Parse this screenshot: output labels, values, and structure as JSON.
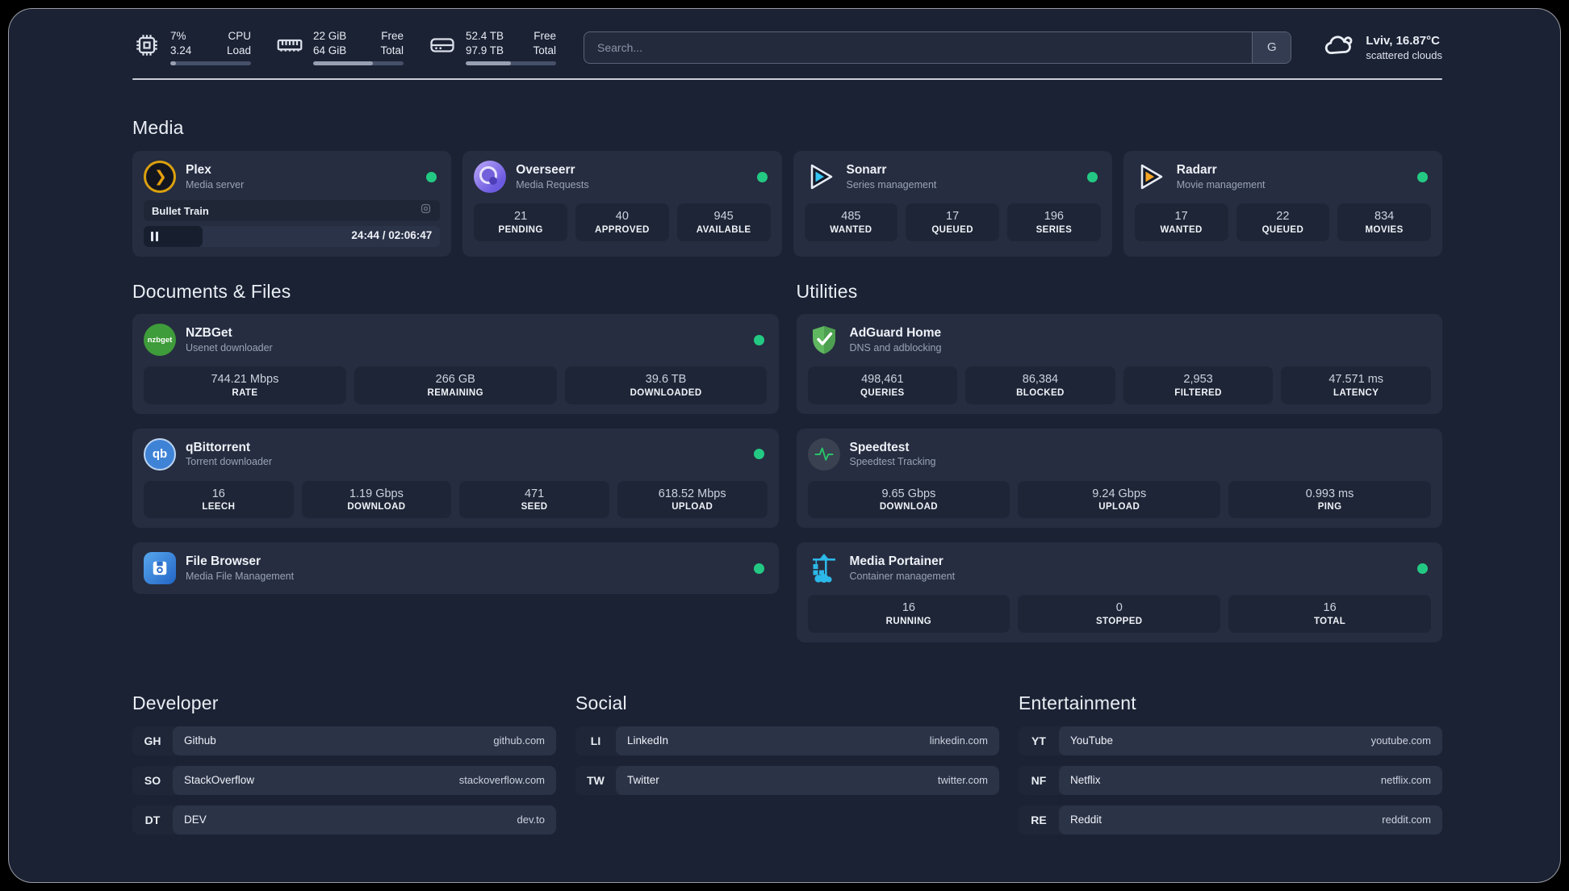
{
  "colors": {
    "page_bg": "#1b2234",
    "card_bg": "#262d40",
    "tile_bg": "#1e2536",
    "status_online": "#23c983",
    "plex_amber": "#e5a00d",
    "sonarr_blue": "#35c5f4",
    "radarr_amber": "#f5a623",
    "portainer_blue": "#2cb8e8"
  },
  "topbar": {
    "system": [
      {
        "icon": "cpu-icon",
        "value1": "7%",
        "value2": "3.24",
        "label1": "CPU",
        "label2": "Load",
        "progress_pct": 7
      },
      {
        "icon": "ram-icon",
        "value1": "22 GiB",
        "value2": "64 GiB",
        "label1": "Free",
        "label2": "Total",
        "progress_pct": 66
      },
      {
        "icon": "disk-icon",
        "value1": "52.4 TB",
        "value2": "97.9 TB",
        "label1": "Free",
        "label2": "Total",
        "progress_pct": 50
      }
    ],
    "search": {
      "placeholder": "Search...",
      "engine_button": "G"
    },
    "weather": {
      "icon": "scattered-clouds-icon",
      "location_temp": "Lviv, 16.87°C",
      "condition": "scattered clouds"
    }
  },
  "media": {
    "title": "Media",
    "plex": {
      "icon": "plex-icon",
      "name": "Plex",
      "desc": "Media server",
      "online": true,
      "now_playing": "Bullet Train",
      "time": "24:44 / 02:06:47",
      "progress_pct": 20
    },
    "cards": [
      {
        "icon": "overseerr-icon",
        "name": "Overseerr",
        "desc": "Media Requests",
        "online": true,
        "stats": [
          {
            "value": "21",
            "label": "PENDING"
          },
          {
            "value": "40",
            "label": "APPROVED"
          },
          {
            "value": "945",
            "label": "AVAILABLE"
          }
        ]
      },
      {
        "icon": "sonarr-icon",
        "name": "Sonarr",
        "desc": "Series management",
        "online": true,
        "stats": [
          {
            "value": "485",
            "label": "WANTED"
          },
          {
            "value": "17",
            "label": "QUEUED"
          },
          {
            "value": "196",
            "label": "SERIES"
          }
        ]
      },
      {
        "icon": "radarr-icon",
        "name": "Radarr",
        "desc": "Movie management",
        "online": true,
        "stats": [
          {
            "value": "17",
            "label": "WANTED"
          },
          {
            "value": "22",
            "label": "QUEUED"
          },
          {
            "value": "834",
            "label": "MOVIES"
          }
        ]
      }
    ]
  },
  "documents": {
    "title": "Documents & Files",
    "cards": [
      {
        "icon": "nzbget-icon",
        "name": "NZBGet",
        "desc": "Usenet downloader",
        "online": true,
        "stats": [
          {
            "value": "744.21 Mbps",
            "label": "RATE"
          },
          {
            "value": "266 GB",
            "label": "REMAINING"
          },
          {
            "value": "39.6 TB",
            "label": "DOWNLOADED"
          }
        ]
      },
      {
        "icon": "qbittorrent-icon",
        "name": "qBittorrent",
        "desc": "Torrent downloader",
        "online": true,
        "stats": [
          {
            "value": "16",
            "label": "LEECH"
          },
          {
            "value": "1.19 Gbps",
            "label": "DOWNLOAD"
          },
          {
            "value": "471",
            "label": "SEED"
          },
          {
            "value": "618.52 Mbps",
            "label": "UPLOAD"
          }
        ]
      },
      {
        "icon": "filebrowser-icon",
        "name": "File Browser",
        "desc": "Media File Management",
        "online": true,
        "stats": []
      }
    ]
  },
  "utilities": {
    "title": "Utilities",
    "cards": [
      {
        "icon": "adguard-icon",
        "name": "AdGuard Home",
        "desc": "DNS and adblocking",
        "online": false,
        "stats": [
          {
            "value": "498,461",
            "label": "QUERIES"
          },
          {
            "value": "86,384",
            "label": "BLOCKED"
          },
          {
            "value": "2,953",
            "label": "FILTERED"
          },
          {
            "value": "47.571 ms",
            "label": "LATENCY"
          }
        ]
      },
      {
        "icon": "speedtest-icon",
        "name": "Speedtest",
        "desc": "Speedtest Tracking",
        "online": false,
        "stats": [
          {
            "value": "9.65 Gbps",
            "label": "DOWNLOAD"
          },
          {
            "value": "9.24 Gbps",
            "label": "UPLOAD"
          },
          {
            "value": "0.993 ms",
            "label": "PING"
          }
        ]
      },
      {
        "icon": "portainer-icon",
        "name": "Media Portainer",
        "desc": "Container management",
        "online": true,
        "stats": [
          {
            "value": "16",
            "label": "RUNNING"
          },
          {
            "value": "0",
            "label": "STOPPED"
          },
          {
            "value": "16",
            "label": "TOTAL"
          }
        ]
      }
    ]
  },
  "bookmarks": {
    "developer": {
      "title": "Developer",
      "items": [
        {
          "abbr": "GH",
          "name": "Github",
          "url": "github.com"
        },
        {
          "abbr": "SO",
          "name": "StackOverflow",
          "url": "stackoverflow.com"
        },
        {
          "abbr": "DT",
          "name": "DEV",
          "url": "dev.to"
        }
      ]
    },
    "social": {
      "title": "Social",
      "items": [
        {
          "abbr": "LI",
          "name": "LinkedIn",
          "url": "linkedin.com"
        },
        {
          "abbr": "TW",
          "name": "Twitter",
          "url": "twitter.com"
        }
      ]
    },
    "entertainment": {
      "title": "Entertainment",
      "items": [
        {
          "abbr": "YT",
          "name": "YouTube",
          "url": "youtube.com"
        },
        {
          "abbr": "NF",
          "name": "Netflix",
          "url": "netflix.com"
        },
        {
          "abbr": "RE",
          "name": "Reddit",
          "url": "reddit.com"
        }
      ]
    }
  }
}
